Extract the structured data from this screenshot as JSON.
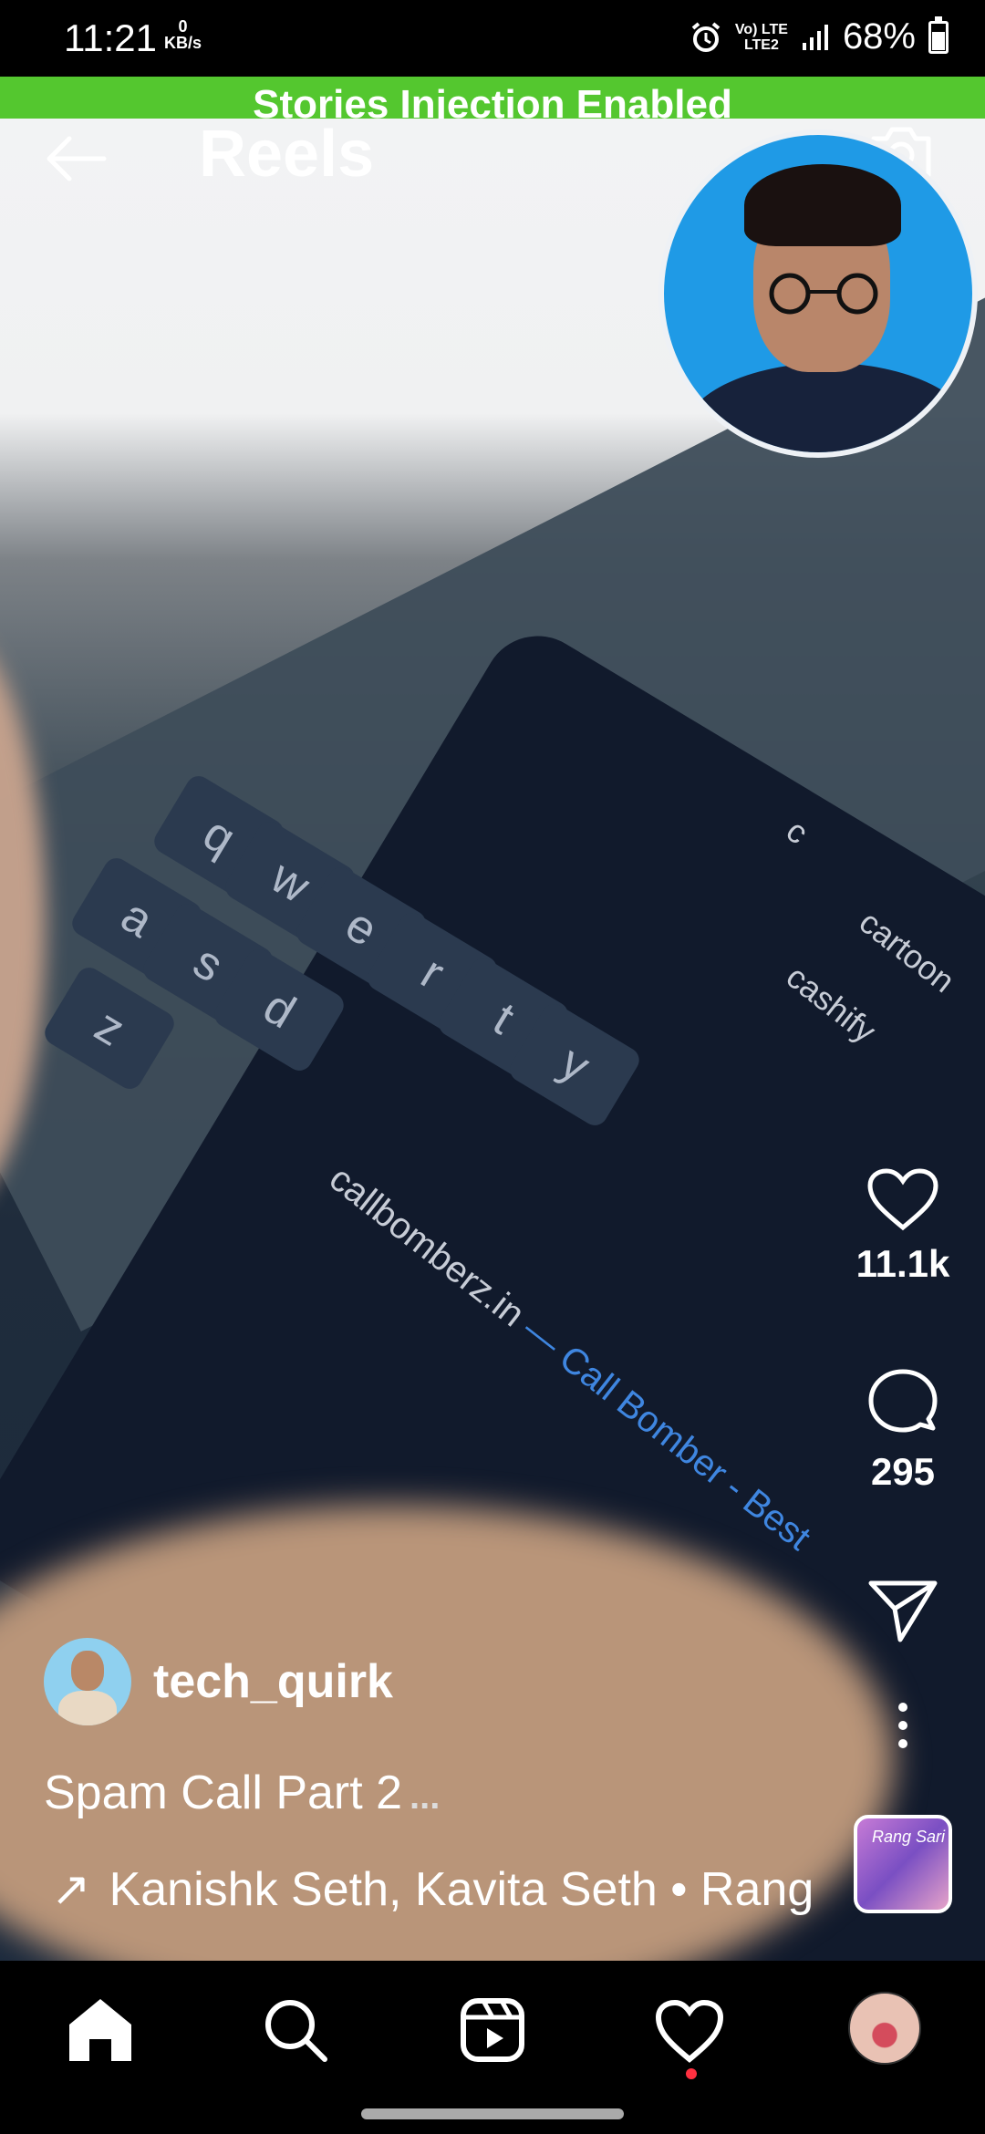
{
  "status_bar": {
    "time": "11:21",
    "speed_value": "0",
    "speed_unit": "KB/s",
    "network_top": "Vo) LTE",
    "network_bottom": "LTE2",
    "battery": "68%"
  },
  "banner": {
    "text": "Stories Injection Enabled",
    "color": "#54c72f"
  },
  "header": {
    "title": "Reels",
    "back_icon": "arrow-left-icon",
    "camera_icon": "camera-icon"
  },
  "video_text": {
    "search_1": "cashify",
    "search_2": "cartoon",
    "search_3": "c",
    "keys": [
      "q",
      "w",
      "e",
      "r",
      "t",
      "y",
      "a",
      "s",
      "d",
      "z"
    ],
    "suggestion_main": "callbomberz.in",
    "suggestion_rest": " — Call Bomber - Best"
  },
  "actions": {
    "likes": "11.1k",
    "comments": "295",
    "like_icon": "heart-icon",
    "comment_icon": "comment-icon",
    "share_icon": "send-icon",
    "more_icon": "more-vertical-icon"
  },
  "post": {
    "username": "tech_quirk",
    "caption": "Spam Call Part 2",
    "caption_more": "...",
    "music_arrow": "↗",
    "music": "Kanishk Seth, Kavita Seth • Rang",
    "audio_cover_text": "Rang Sari"
  },
  "nav": {
    "items": [
      "home-icon",
      "search-icon",
      "reels-icon",
      "activity-icon",
      "profile-avatar"
    ]
  }
}
